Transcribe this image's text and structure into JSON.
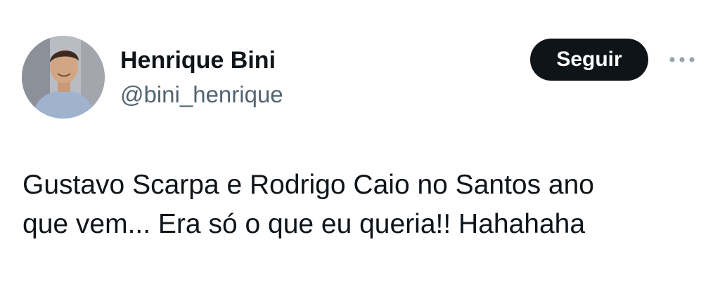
{
  "author": {
    "display_name": "Henrique Bini",
    "handle": "@bini_henrique",
    "avatar": "profile-photo"
  },
  "actions": {
    "follow_label": "Seguir",
    "more_icon": "more-horizontal-icon"
  },
  "tweet": {
    "text": "Gustavo Scarpa e Rodrigo Caio no Santos ano\nque vem... Era só o que eu queria!! Hahahaha"
  },
  "colors": {
    "primary_text": "#0f1419",
    "secondary_text": "#536471",
    "button_bg": "#0f1419",
    "button_text": "#ffffff",
    "background": "#ffffff"
  }
}
